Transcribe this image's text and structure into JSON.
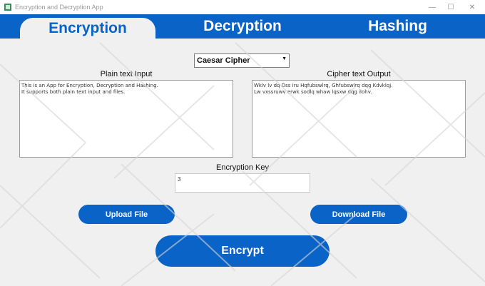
{
  "window": {
    "title": "Encryption and Decryption App",
    "controls": {
      "minimize": "—",
      "maximize": "☐",
      "close": "✕"
    }
  },
  "tabs": [
    {
      "label": "Encryption",
      "active": true
    },
    {
      "label": "Decryption",
      "active": false
    },
    {
      "label": "Hashing",
      "active": false
    }
  ],
  "cipher_select": {
    "value": "Caesar Cipher"
  },
  "plain_input": {
    "label": "Plain text Input",
    "text": "This is an App for Encryption, Decryption and Hashing.\nIt supports both plain text input and files."
  },
  "cipher_output": {
    "label": "Cipher text Output",
    "text": "Wklv lv dq Dss iru Hqfubswlrq, Ghfubswlrq dqg Kdvklqj.\nLw vxssruwv erwk sodlq whaw lqsxw dqg ilohv."
  },
  "key": {
    "label": "Encryption Key",
    "value": "3"
  },
  "buttons": {
    "upload": "Upload File",
    "download": "Download File",
    "encrypt": "Encrypt"
  },
  "colors": {
    "accent": "#0a63c6",
    "background": "#f0f0f0"
  }
}
